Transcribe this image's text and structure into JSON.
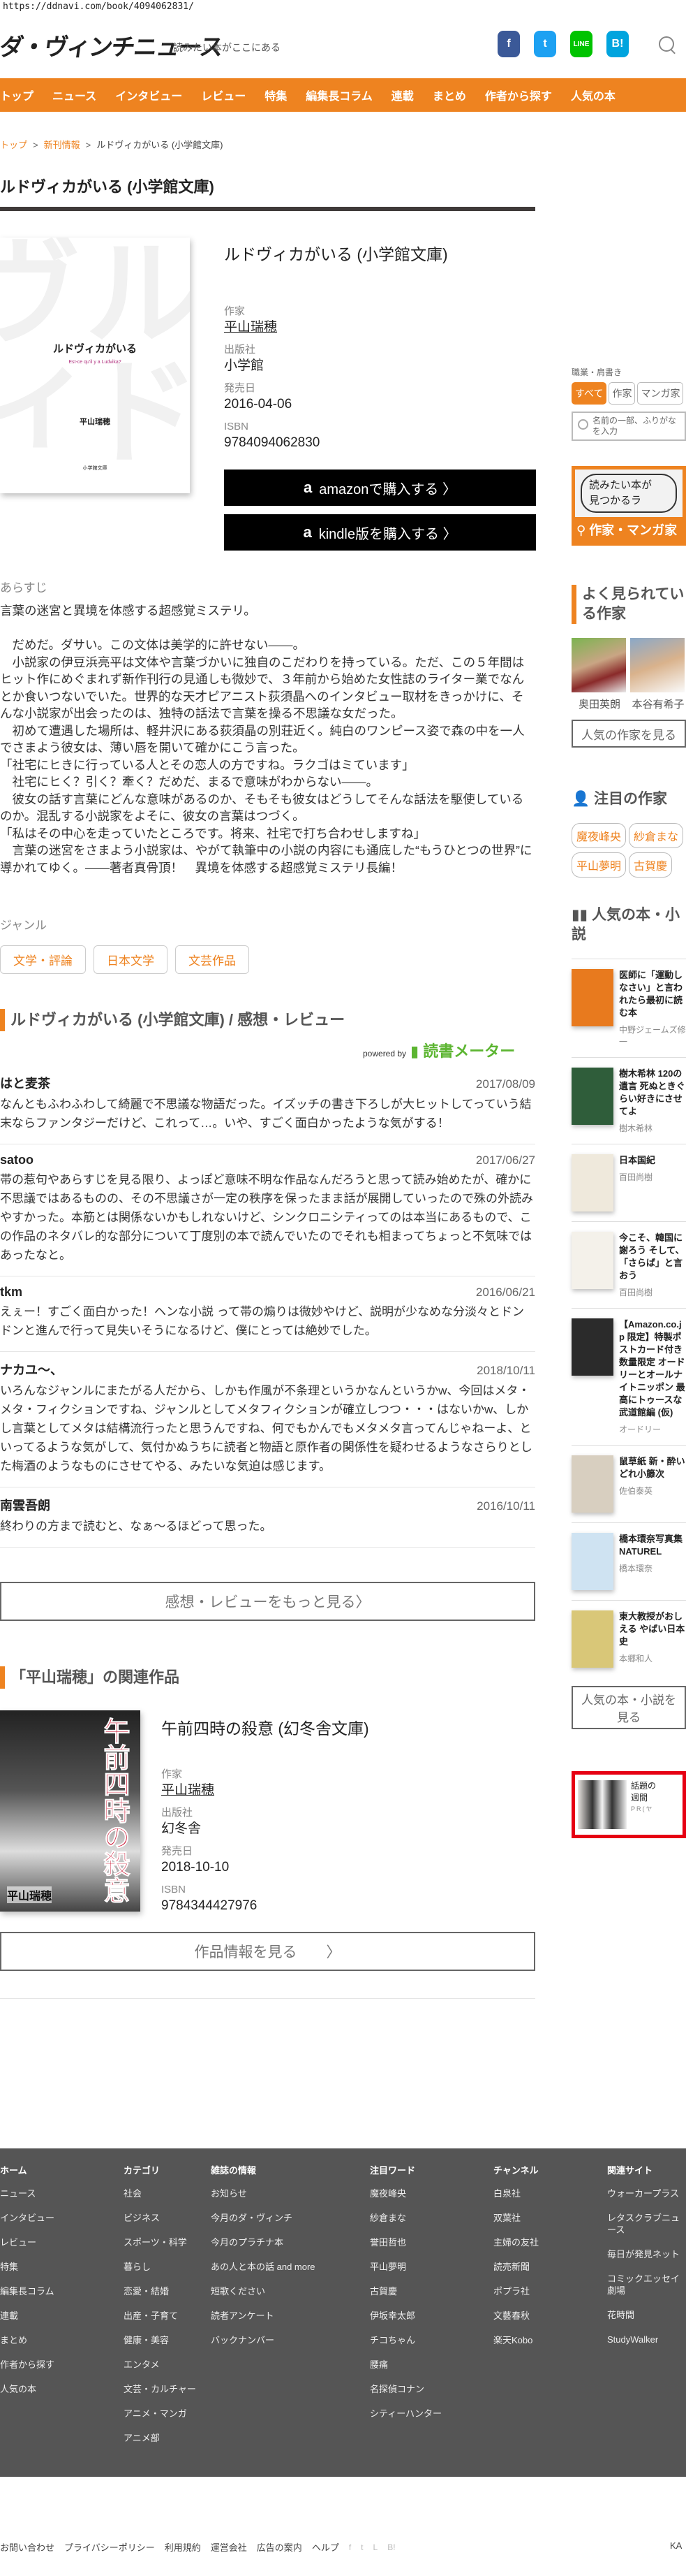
{
  "url": "https://ddnavi.com/book/4094062831/",
  "header": {
    "logo": "ダ・ヴィンチニュース",
    "tagline": "読みたい本がここにある",
    "social": [
      {
        "name": "facebook",
        "glyph": "f",
        "color": "#3b5998"
      },
      {
        "name": "twitter",
        "glyph": "t",
        "color": "#1da1f2"
      },
      {
        "name": "line",
        "glyph": "LINE",
        "color": "#00c300"
      },
      {
        "name": "hatena",
        "glyph": "B!",
        "color": "#00a4de"
      }
    ]
  },
  "nav": [
    "トップ",
    "ニュース",
    "インタビュー",
    "レビュー",
    "特集",
    "編集長コラム",
    "連載",
    "まとめ",
    "作者から探す",
    "人気の本"
  ],
  "breadcrumb": {
    "top": "トップ",
    "section": "新刊情報",
    "current": "ルドヴィカがいる (小学館文庫)",
    "sep": ">"
  },
  "book": {
    "page_title": "ルドヴィカがいる (小学館文庫)",
    "title": "ルドヴィカがいる (小学館文庫)",
    "cover": {
      "bg": "ルドヴィカがいる",
      "title": "ルドヴィカがいる",
      "subtitle": "Est-ce qu'il y a Ludvika?",
      "author": "平山瑞穂",
      "label": "小学館文庫"
    },
    "author_label": "作家",
    "author": "平山瑞穂",
    "publisher_label": "出版社",
    "publisher": "小学館",
    "release_label": "発売日",
    "release": "2016-04-06",
    "isbn_label": "ISBN",
    "isbn": "9784094062830",
    "amazon_button": "amazonで購入する 〉",
    "kindle_button": "kindle版を購入する 〉",
    "amazon_logo": "a",
    "synopsis_label": "あらすじ",
    "synopsis": "言葉の迷宮と異境を体感する超感覚ミステリ。\n\n　だめだ。ダサい。この文体は美学的に許せない――。\n　小説家の伊豆浜亮平は文体や言葉づかいに独自のこだわりを持っている。ただ、この５年間はヒット作にめぐまれず新作刊行の見通しも微妙で、３年前から始めた女性誌のライター業でなんとか食いつないでいた。世界的な天才ピアニスト荻須晶へのインタビュー取材をきっかけに、そんな小説家が出会ったのは、独特の話法で言葉を操る不思議な女だった。\n　初めて遭遇した場所は、軽井沢にある荻須晶の別荘近く。純白のワンピース姿で森の中を一人でさまよう彼女は、薄い唇を開いて確かにこう言った。\n「社宅にヒきに行っている人とその恋人の方ですね。ラクゴはミています」\n　社宅にヒく？引く？牽く？だめだ、まるで意味がわからない――。\n　彼女の話す言葉にどんな意味があるのか、そもそも彼女はどうしてそんな話法を駆使しているのか。混乱する小説家をよそに、彼女の言葉はつづく。\n「私はその中心を走っていたところです。将来、社宅で打ち合わせしますね」\n　言葉の迷宮をさまよう小説家は、やがて執筆中の小説の内容にも通底した“もうひとつの世界”に導かれてゆく。――著者真骨頂！　異境を体感する超感覚ミステリ長編！",
    "genre_label": "ジャンル",
    "genres": [
      "文学・評論",
      "日本文学",
      "文芸作品"
    ]
  },
  "reviews": {
    "heading": "ルドヴィカがいる (小学館文庫) / 感想・レビュー",
    "powered_by": "powered by",
    "powered_brand": "読書メーター",
    "items": [
      {
        "name": "はと麦茶",
        "date": "2017/08/09",
        "text": "なんともふわふわして綺麗で不思議な物語だった。イズッチの書き下ろしが大ヒットしてっていう結末ならファンタジーだけど、これって…。いや、すごく面白かったような気がする！"
      },
      {
        "name": "satoo",
        "date": "2017/06/27",
        "text": "帯の惹句やあらすじを見る限り、よっぽど意味不明な作品なんだろうと思って読み始めたが、確かに不思議ではあるものの、その不思議さが一定の秩序を保ったまま話が展開していったので殊の外読みやすかった。本筋とは関係ないかもしれないけど、シンクロニシティってのは本当にあるもので、この作品のネタバレ的な部分について丁度別の本で読んでいたのでそれも相まってちょっと不気味ではあったなと。"
      },
      {
        "name": "tkm",
        "date": "2016/06/21",
        "text": "えぇー！すごく面白かった！ヘンな小説 って帯の煽りは微妙やけど、説明が少なめな分淡々とドンドンと進んで行って見失いそうになるけど、僕にとっては絶妙でした。"
      },
      {
        "name": "ナカユ〜、",
        "date": "2018/10/11",
        "text": "いろんなジャンルにまたがる人だから、しかも作風が不条理というかなんというかw、今回はメタ・メタ・フィクションですね、ジャンルとしてメタフィクションが確立しつつ・・・はないかw、しかし言葉としてメタは結構流行ったと思うんですね、何でもかんでもメタメタ言ってんじゃねーよ、といってるような気がして、気付かぬうちに読者と物語と原作者の関係性を疑わせるようなさらりとした梅酒のようなものにさせてやる、みたいな気迫は感じます。"
      },
      {
        "name": "南雲吾朗",
        "date": "2016/10/11",
        "text": "終わりの方まで読むと、なぁ〜るほどって思った。"
      }
    ],
    "more_button": "感想・レビューをもっと見る〉"
  },
  "related": {
    "heading": "「平山瑞穂」の関連作品",
    "title": "午前四時の殺意 (幻冬舎文庫)",
    "cover": {
      "text": "午前四時の殺意",
      "author": "平山瑞穂"
    },
    "author_label": "作家",
    "author": "平山瑞穂",
    "publisher_label": "出版社",
    "publisher": "幻冬舎",
    "release_label": "発売日",
    "release": "2018-10-10",
    "isbn_label": "ISBN",
    "isbn": "9784344427976",
    "button": "作品情報を見る　　〉"
  },
  "sidebar": {
    "filter_label": "職業・肩書き",
    "tabs": [
      "すべて",
      "作家",
      "マンガ家"
    ],
    "search_placeholder": "名前の一部、ふりがなを入力",
    "banner_bubble": "読みたい本が\n見つかるラ",
    "banner_text": "作家・マンガ家",
    "popular_heading": "よく見られている作家",
    "popular_authors": [
      "奥田英朗",
      "本谷有希子"
    ],
    "popular_button": "人気の作家を見る",
    "featured_heading": "注目の作家",
    "featured_authors": [
      "魔夜峰央",
      "紗倉まな",
      "平山夢明",
      "古賀慶"
    ],
    "books_heading": "人気の本・小説",
    "books": [
      {
        "title": "医師に「運動しなさい」と言われたら最初に読む本",
        "author": "中野ジェームズ修一",
        "color": "#e87a1e"
      },
      {
        "title": "樹木希林 120の遺言 死ぬときぐらい好きにさせてよ",
        "author": "樹木希林",
        "color": "#2f5d3a"
      },
      {
        "title": "日本国紀",
        "author": "百田尚樹",
        "color": "#efe9dc"
      },
      {
        "title": "今こそ、韓国に謝ろう そして、「さらば」と言おう",
        "author": "百田尚樹",
        "color": "#f4f1ea"
      },
      {
        "title": "【Amazon.co.jp 限定】特製ポストカード付き 数量限定 オードリーとオールナイトニッポン 最高にトゥースな武道館編 (仮)",
        "author": "オードリー",
        "color": "#2b2b2b"
      },
      {
        "title": "鼠草紙 新・酔いどれ小籐次",
        "author": "佐伯泰英",
        "color": "#d8cfc0"
      },
      {
        "title": "橋本環奈写真集 NATUREL",
        "author": "橋本環奈",
        "color": "#cfe3f2"
      },
      {
        "title": "東大教授がおしえる やばい日本史",
        "author": "本郷和人",
        "color": "#d9c778"
      }
    ],
    "books_button": "人気の本・小説を見る",
    "ad": {
      "line1": "話題の",
      "line2": "週間",
      "pr": "PR(ヤ"
    }
  },
  "footer": {
    "columns": [
      {
        "heading": "ホーム",
        "links": [
          "ニュース",
          "インタビュー",
          "レビュー",
          "特集",
          "編集長コラム",
          "連載",
          "まとめ",
          "作者から探す",
          "人気の本"
        ]
      },
      {
        "heading": "カテゴリ",
        "links": [
          "社会",
          "ビジネス",
          "スポーツ・科学",
          "暮らし",
          "恋愛・結婚",
          "出産・子育て",
          "健康・美容",
          "エンタメ",
          "文芸・カルチャー",
          "アニメ・マンガ",
          "アニメ部"
        ]
      },
      {
        "heading": "雑誌の情報",
        "links": [
          "お知らせ",
          "今月のダ・ヴィンチ",
          "今月のプラチナ本",
          "あの人と本の話 and more",
          "短歌ください",
          "読者アンケート",
          "バックナンバー"
        ]
      },
      {
        "heading": "注目ワード",
        "links": [
          "魔夜峰央",
          "紗倉まな",
          "誉田哲也",
          "平山夢明",
          "古賀慶",
          "伊坂幸太郎",
          "チコちゃん",
          "腰痛",
          "名探偵コナン",
          "シティーハンター"
        ]
      },
      {
        "heading": "チャンネル",
        "links": [
          "白泉社",
          "双葉社",
          "主婦の友社",
          "読売新聞",
          "ポプラ社",
          "文藝春秋",
          "楽天Kobo"
        ]
      },
      {
        "heading": "関連サイト",
        "links": [
          "ウォーカープラス",
          "レタスクラブニュース",
          "毎日が発見ネット",
          "コミックエッセイ劇場",
          "花時間",
          "StudyWalker"
        ]
      }
    ],
    "bottom_links": [
      "お問い合わせ",
      "プライバシーポリシー",
      "利用規約",
      "運営会社",
      "広告の案内",
      "ヘルプ"
    ],
    "bottom_icons": [
      "f",
      "t",
      "L",
      "B!"
    ],
    "corp": "KA"
  },
  "colors": {
    "accent": "#ee8320",
    "footer_bg": "#555555",
    "ad_border": "#e60012",
    "brand_green": "#5cb531"
  }
}
